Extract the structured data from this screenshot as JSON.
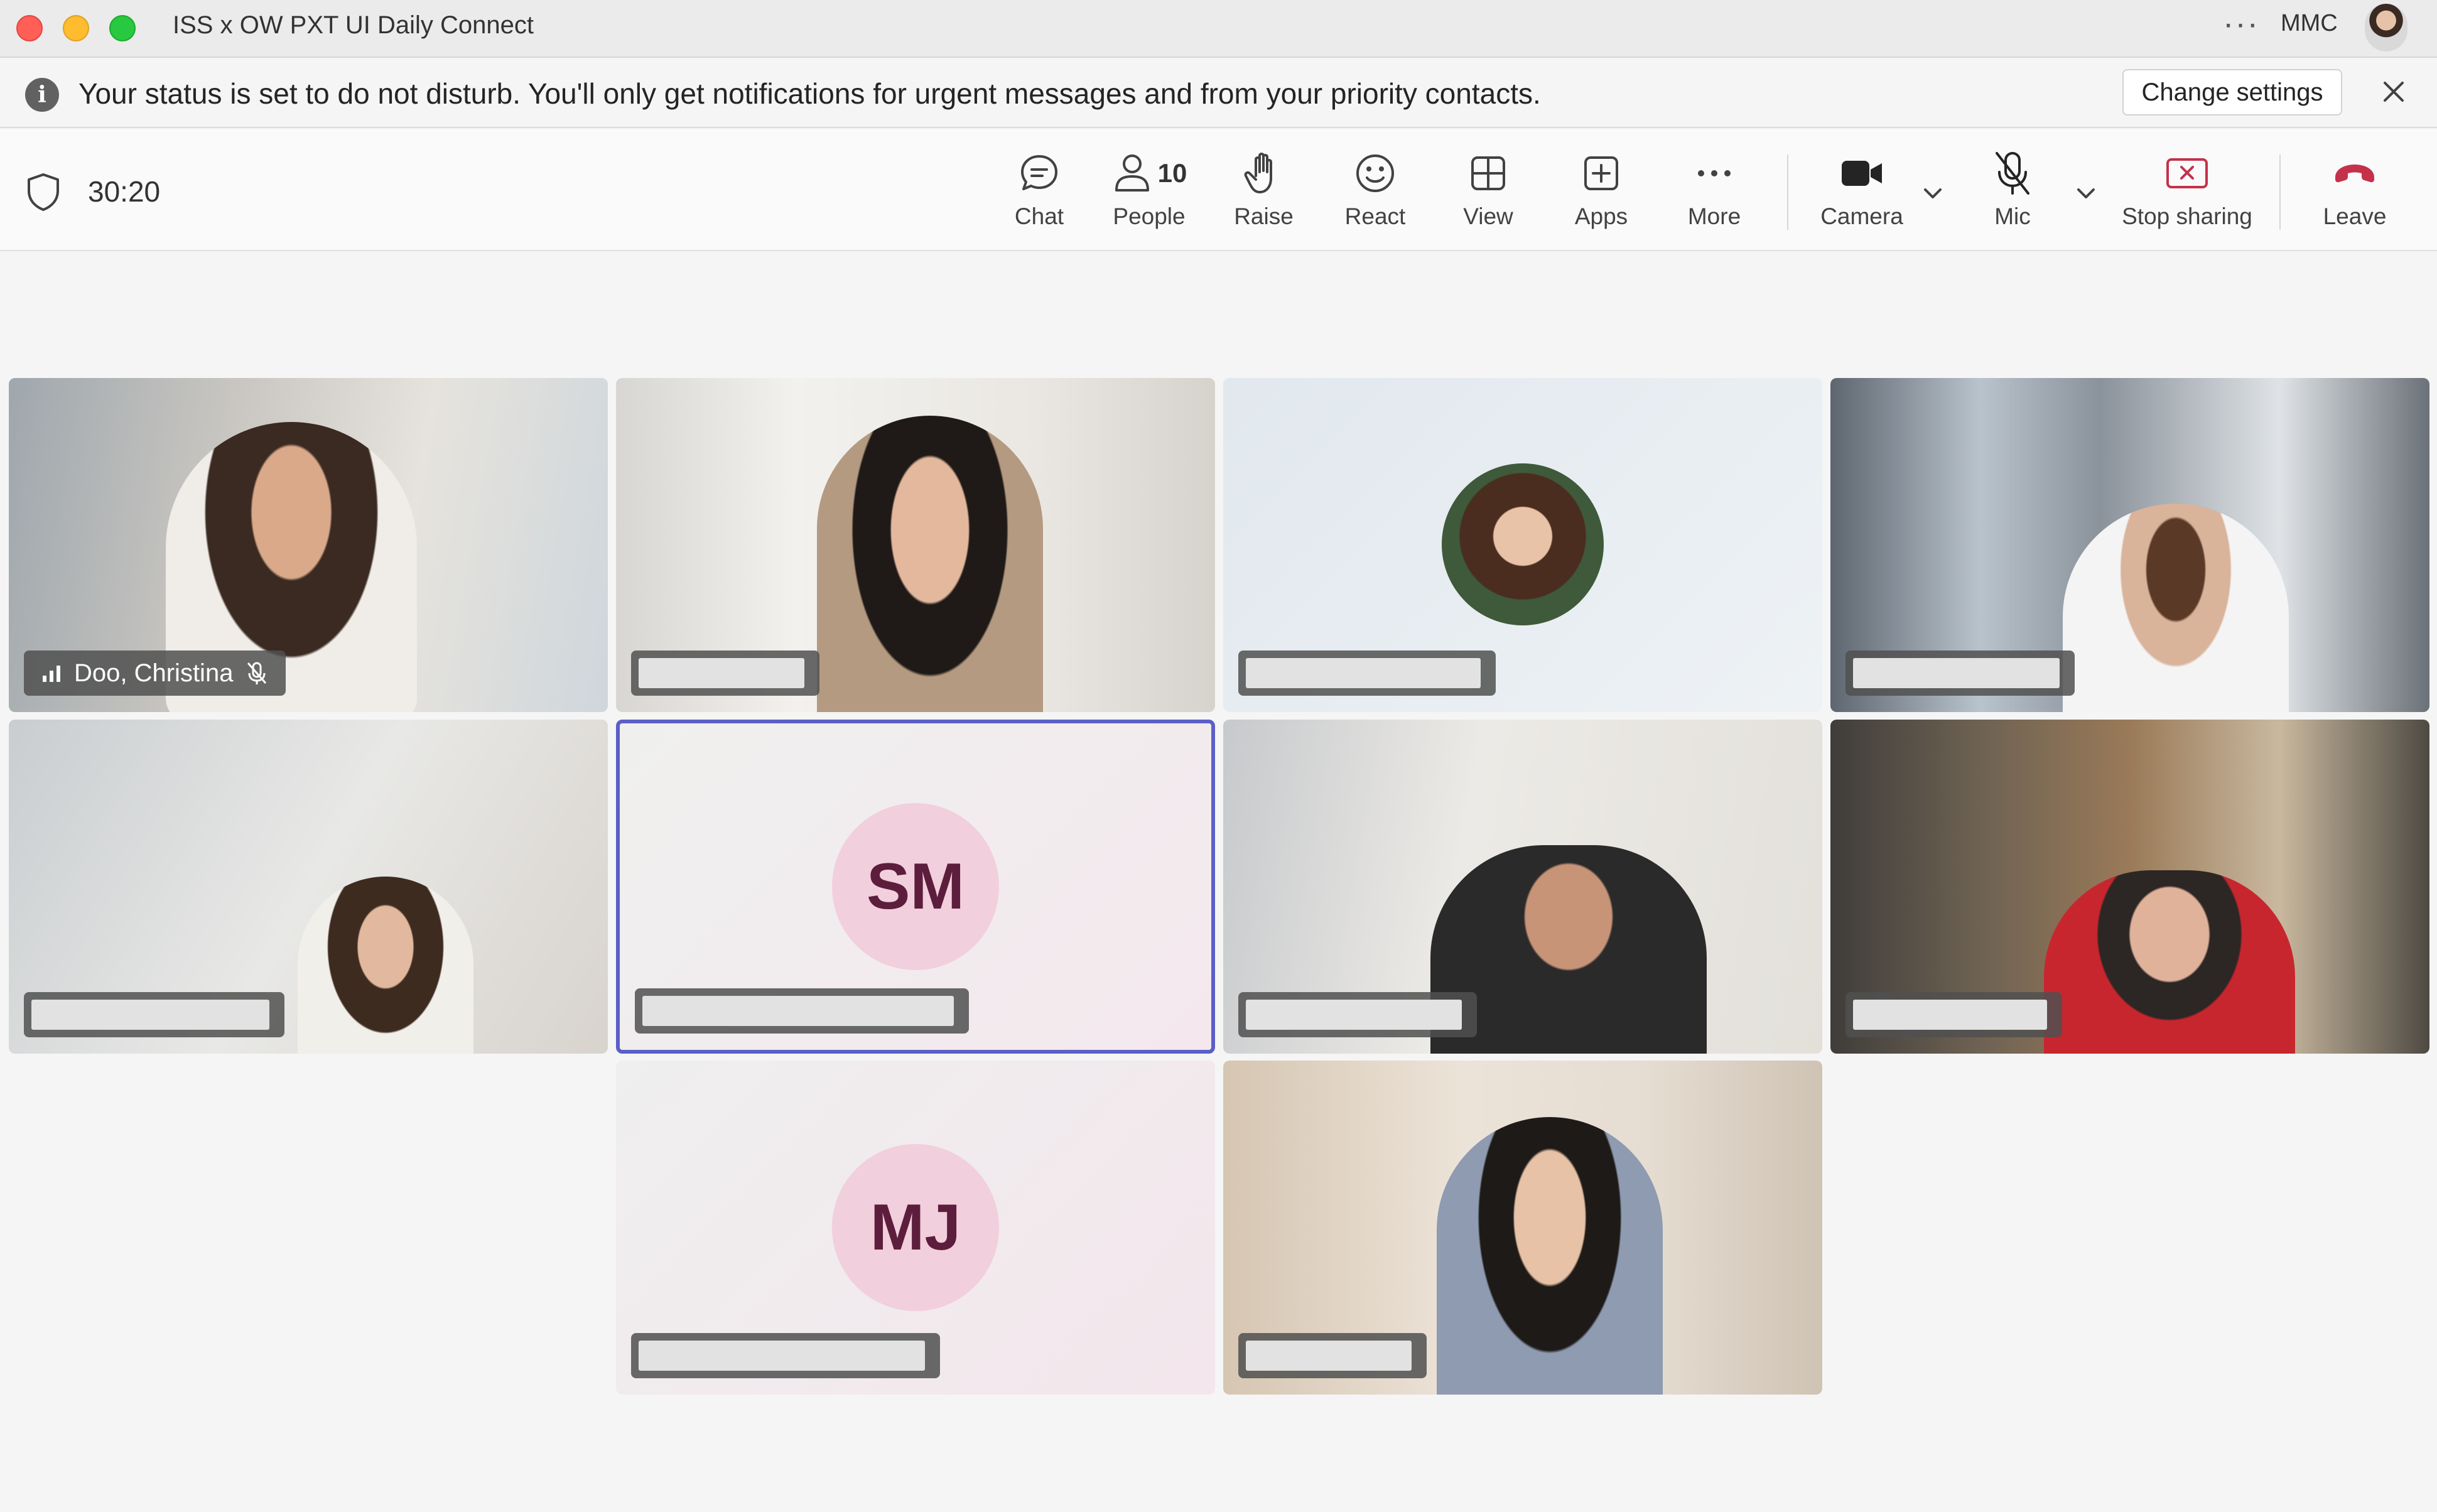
{
  "window": {
    "title": "ISS x OW PXT UI Daily Connect",
    "more_label": "···",
    "user_label": "MMC"
  },
  "banner": {
    "message": "Your status is set to do not disturb. You'll only get notifications for urgent messages and from your priority contacts.",
    "change_settings_label": "Change settings"
  },
  "toolbar": {
    "timer": "30:20",
    "chat_label": "Chat",
    "people_label": "People",
    "people_count": "10",
    "raise_label": "Raise",
    "react_label": "React",
    "view_label": "View",
    "apps_label": "Apps",
    "more_label": "More",
    "camera_label": "Camera",
    "mic_label": "Mic",
    "stop_sharing_label": "Stop sharing",
    "leave_label": "Leave",
    "leave_color": "#c4314b",
    "stop_sharing_color": "#c4314b"
  },
  "participants": [
    {
      "name": "Doo, Christina",
      "video": true,
      "muted": true
    },
    {
      "name": "",
      "video": true
    },
    {
      "name": "",
      "video": false,
      "has_photo": true
    },
    {
      "name": "",
      "video": true
    },
    {
      "name": "",
      "video": true
    },
    {
      "name": "",
      "video": false,
      "initials": "SM",
      "speaking": true
    },
    {
      "name": "",
      "video": true
    },
    {
      "name": "",
      "video": true
    },
    {
      "name": "",
      "video": false,
      "initials": "MJ"
    },
    {
      "name": "",
      "video": true
    }
  ],
  "colors": {
    "accent": "#5b5fc7",
    "avatar_bg": "#f2cfdc",
    "avatar_text": "#5c1e3c"
  }
}
